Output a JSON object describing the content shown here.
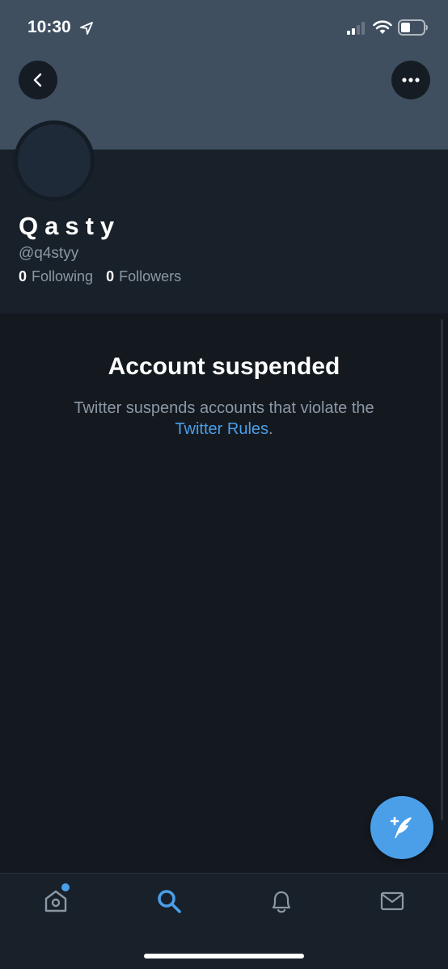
{
  "status_bar": {
    "time": "10:30",
    "icons": [
      "location-arrow-icon",
      "signal-icon",
      "wifi-icon",
      "battery-icon"
    ]
  },
  "header": {
    "back_icon": "chevron-left-icon",
    "more_icon": "more-horizontal-icon"
  },
  "profile": {
    "display_name": "Qasty",
    "handle": "@q4styy",
    "following_count": "0",
    "following_label": "Following",
    "followers_count": "0",
    "followers_label": "Followers"
  },
  "suspension": {
    "title": "Account suspended",
    "text": "Twitter suspends accounts that violate the",
    "link": "Twitter Rules",
    "suffix": "."
  },
  "fab": {
    "icon": "compose-tweet-icon"
  },
  "tab_bar": {
    "tabs": [
      {
        "name": "home",
        "icon": "home-icon",
        "has_notification_dot": true
      },
      {
        "name": "search",
        "icon": "search-icon",
        "active": true
      },
      {
        "name": "notifications",
        "icon": "bell-icon"
      },
      {
        "name": "messages",
        "icon": "mail-icon"
      }
    ]
  },
  "colors": {
    "accent": "#4a9fe8",
    "background": "#141920",
    "banner": "#3f4f60",
    "secondary_text": "#8b98a5"
  }
}
